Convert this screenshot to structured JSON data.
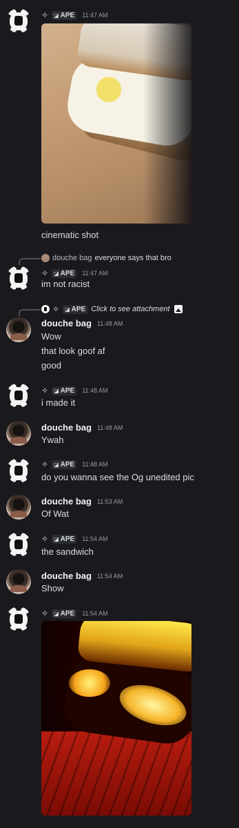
{
  "users": {
    "ape": {
      "tag": "APE",
      "tag_icon": "leaf-icon"
    },
    "douche": {
      "name": "douche bag"
    }
  },
  "messages": [
    {
      "time": "11:47 AM",
      "text": "cinematic shot"
    },
    {
      "time": "11:47 AM",
      "reply_name": "douche bag",
      "reply_text": "everyone says that bro",
      "text": "im not racist"
    },
    {
      "time": "11:48 AM",
      "reply_tag": "APE",
      "reply_text": "Click to see attachment",
      "lines": [
        "Wow",
        "that look goof af",
        "good"
      ]
    },
    {
      "time": "11:48 AM",
      "text": "i made it"
    },
    {
      "time": "11:48 AM",
      "text": "Ywah"
    },
    {
      "time": "11:48 AM",
      "text": "do you wanna see the Og unedited pic"
    },
    {
      "time": "11:53 AM",
      "text": "Of Wat"
    },
    {
      "time": "11:54 AM",
      "text": "the sandwich"
    },
    {
      "time": "11:54 AM",
      "text": "Show"
    },
    {
      "time": "11:54 AM"
    }
  ],
  "icons": {
    "sparkle": "✧",
    "tag": "leaf-icon",
    "image": "image-icon"
  }
}
